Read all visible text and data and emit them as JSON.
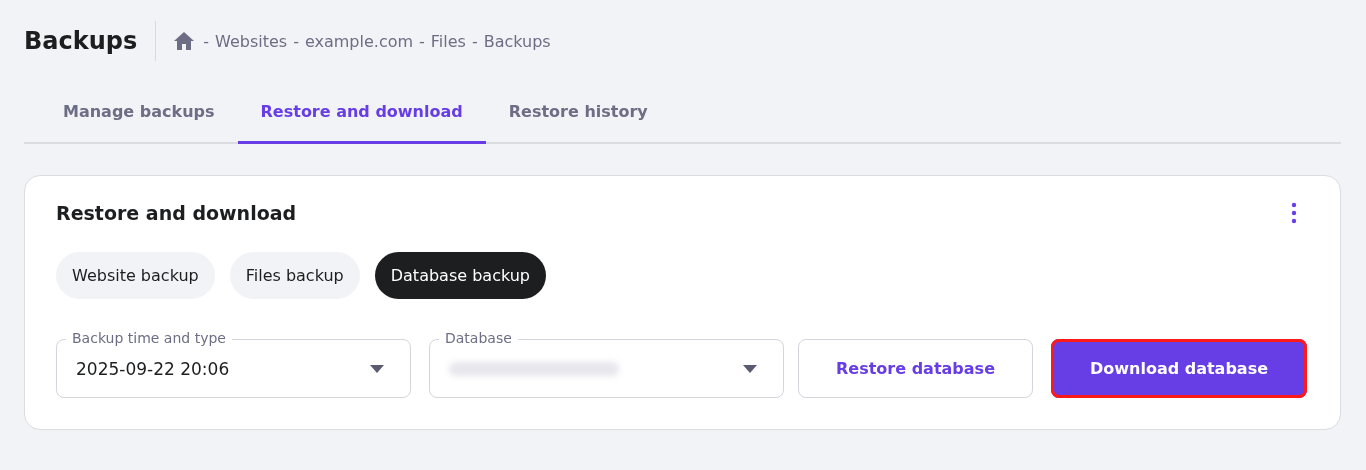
{
  "page_title": "Backups",
  "breadcrumb": {
    "separator": "-",
    "items": [
      "Websites",
      "example.com",
      "Files",
      "Backups"
    ]
  },
  "tabs": [
    {
      "label": "Manage backups",
      "selected": false
    },
    {
      "label": "Restore and download",
      "selected": true
    },
    {
      "label": "Restore history",
      "selected": false
    }
  ],
  "card": {
    "title": "Restore and download",
    "backup_types": [
      {
        "label": "Website backup",
        "selected": false
      },
      {
        "label": "Files backup",
        "selected": false
      },
      {
        "label": "Database backup",
        "selected": true
      }
    ],
    "fields": [
      {
        "label": "Backup time and type",
        "value": "2025-09-22 20:06",
        "blurred": false
      },
      {
        "label": "Database",
        "blurred": true
      }
    ],
    "buttons": [
      {
        "label": "Restore database",
        "kind": "secondary",
        "highlighted": false
      },
      {
        "label": "Download database",
        "kind": "primary",
        "highlighted": true
      }
    ]
  }
}
